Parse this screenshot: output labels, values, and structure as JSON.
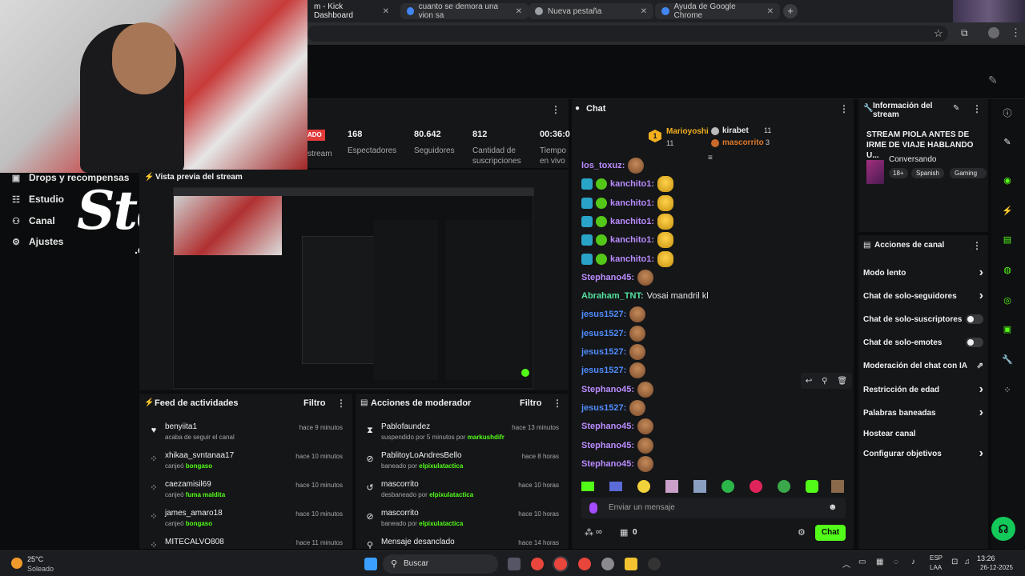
{
  "browser": {
    "tabs": [
      {
        "title": "m - Kick Dashboard",
        "active": true
      },
      {
        "title": "cuanto se demora una vion sa",
        "active": false
      },
      {
        "title": "Nueva pestaña",
        "active": false
      },
      {
        "title": "Ayuda de Google Chrome",
        "active": false
      }
    ],
    "new_tab": "+"
  },
  "sidebar": {
    "items": [
      {
        "label": "Drops y recompensas",
        "icon": "gift-icon"
      },
      {
        "label": "Estudio",
        "icon": "studio-icon"
      },
      {
        "label": "Canal",
        "icon": "channel-icon"
      },
      {
        "label": "Ajustes",
        "icon": "gear-icon"
      }
    ]
  },
  "overlay": {
    "stake_logo": "Stake",
    "stake_sub": ".com"
  },
  "stats": {
    "live_badge": "ADO",
    "stream_label": "stream",
    "items": [
      {
        "value": "168",
        "label": "Espectadores"
      },
      {
        "value": "80.642",
        "label": "Seguidores"
      },
      {
        "value": "812",
        "label": "Cantidad de suscripciones"
      },
      {
        "value": "00:36:0",
        "label": "Tiempo en vivo"
      }
    ]
  },
  "preview": {
    "title": "Vista previa del stream"
  },
  "activity_feed": {
    "title": "Feed de actividades",
    "filter": "Filtro",
    "rows": [
      {
        "name": "benyiita1",
        "sub": "acaba de seguir el canal",
        "highlight": "",
        "time": "hace 9 minutos",
        "icon": "heart-icon"
      },
      {
        "name": "xhikaa_svntanaa17",
        "sub": "canjeó ",
        "highlight": "bongaso",
        "time": "hace 10 minutos",
        "icon": "points-icon"
      },
      {
        "name": "caezamisil69",
        "sub": "canjeó ",
        "highlight": "fuma maldita",
        "time": "hace 10 minutos",
        "icon": "points-icon"
      },
      {
        "name": "james_amaro18",
        "sub": "canjeó ",
        "highlight": "bongaso",
        "time": "hace 10 minutos",
        "icon": "points-icon"
      },
      {
        "name": "MITECALVO808",
        "sub": "",
        "highlight": "",
        "time": "hace 11 minutos",
        "icon": "points-icon"
      }
    ]
  },
  "mod_actions": {
    "title": "Acciones de moderador",
    "filter": "Filtro",
    "rows": [
      {
        "name": "Pablofaundez",
        "sub": "suspendido por 5 minutos por ",
        "highlight": "markushdifr",
        "time": "hace 13 minutos",
        "icon": "hourglass-icon"
      },
      {
        "name": "PablitoyLoAndresBello",
        "sub": "baneado por ",
        "highlight": "elpixulatactica",
        "time": "hace 8 horas",
        "icon": "ban-icon"
      },
      {
        "name": "mascorrito",
        "sub": "desbaneado por ",
        "highlight": "elpixulatactica",
        "time": "hace 10 horas",
        "icon": "undo-icon"
      },
      {
        "name": "mascorrito",
        "sub": "baneado por ",
        "highlight": "elpixulatactica",
        "time": "hace 10 horas",
        "icon": "ban-icon"
      },
      {
        "name": "Mensaje desanclado",
        "sub": "",
        "highlight": "",
        "time": "hace 14 horas",
        "icon": "pin-icon"
      }
    ]
  },
  "chat": {
    "title": "Chat",
    "leaderboard": [
      {
        "rank": "1",
        "name": "Marioyoshi",
        "count": "11"
      },
      {
        "rank": "",
        "name": "kirabet",
        "count": "11"
      },
      {
        "rank": "",
        "name": "mascorrito",
        "count": "3"
      }
    ],
    "messages": [
      {
        "user": "los_toxuz:",
        "color": "#b98cff",
        "text": "",
        "emote": "monkey",
        "badges": false
      },
      {
        "user": "kanchito1:",
        "color": "#b98cff",
        "text": "",
        "emote": "thumb",
        "badges": true
      },
      {
        "user": "kanchito1:",
        "color": "#b98cff",
        "text": "",
        "emote": "thumb",
        "badges": true
      },
      {
        "user": "kanchito1:",
        "color": "#b98cff",
        "text": "",
        "emote": "thumb",
        "badges": true
      },
      {
        "user": "kanchito1:",
        "color": "#b98cff",
        "text": "",
        "emote": "thumb",
        "badges": true
      },
      {
        "user": "kanchito1:",
        "color": "#b98cff",
        "text": "",
        "emote": "thumb",
        "badges": true
      },
      {
        "user": "Stephano45:",
        "color": "#b98cff",
        "text": "",
        "emote": "monkey",
        "badges": false
      },
      {
        "user": "Abraham_TNT:",
        "color": "#53e0a0",
        "text": "Vosai mandril kl",
        "emote": "",
        "badges": false
      },
      {
        "user": "jesus1527:",
        "color": "#4f8dff",
        "text": "",
        "emote": "monkey",
        "badges": false
      },
      {
        "user": "jesus1527:",
        "color": "#4f8dff",
        "text": "",
        "emote": "monkey",
        "badges": false
      },
      {
        "user": "jesus1527:",
        "color": "#4f8dff",
        "text": "",
        "emote": "monkey",
        "badges": false
      },
      {
        "user": "jesus1527:",
        "color": "#4f8dff",
        "text": "",
        "emote": "monkey",
        "badges": false
      },
      {
        "user": "Stephano45:",
        "color": "#b98cff",
        "text": "",
        "emote": "monkey",
        "badges": false
      },
      {
        "user": "jesus1527:",
        "color": "#4f8dff",
        "text": "",
        "emote": "monkey",
        "badges": false
      },
      {
        "user": "Stephano45:",
        "color": "#b98cff",
        "text": "",
        "emote": "monkey",
        "badges": false
      },
      {
        "user": "Stephano45:",
        "color": "#b98cff",
        "text": "",
        "emote": "monkey",
        "badges": false
      },
      {
        "user": "Stephano45:",
        "color": "#b98cff",
        "text": "",
        "emote": "monkey",
        "badges": false
      }
    ],
    "input_placeholder": "Enviar un mensaje",
    "points": "0",
    "send_label": "Chat"
  },
  "stream_info": {
    "title": "Información del stream",
    "stream_title": "STREAM PIOLA ANTES DE IRME DE VIAJE HABLANDO U...",
    "category": "Conversando",
    "tags": [
      "18+",
      "Spanish",
      "Gaming"
    ]
  },
  "channel_actions": {
    "title": "Acciones de canal",
    "items": [
      {
        "label": "Modo lento",
        "type": "chevron"
      },
      {
        "label": "Chat de solo-seguidores",
        "type": "chevron"
      },
      {
        "label": "Chat de solo-suscriptores",
        "type": "toggle"
      },
      {
        "label": "Chat de solo-emotes",
        "type": "toggle"
      },
      {
        "label": "Moderación del chat con IA",
        "type": "external"
      },
      {
        "label": "Restricción de edad",
        "type": "chevron"
      },
      {
        "label": "Palabras baneadas",
        "type": "chevron"
      },
      {
        "label": "Hostear canal",
        "type": "none"
      },
      {
        "label": "Configurar objetivos",
        "type": "chevron"
      }
    ]
  },
  "taskbar": {
    "weather_temp": "25°C",
    "weather_desc": "Soleado",
    "search": "Buscar",
    "lang_top": "ESP",
    "lang_bottom": "LAA",
    "time": "13:26",
    "date": "26-12-2025"
  },
  "colors": {
    "accent": "#53fc18",
    "panel": "#151618",
    "bg": "#0b0c0d"
  }
}
